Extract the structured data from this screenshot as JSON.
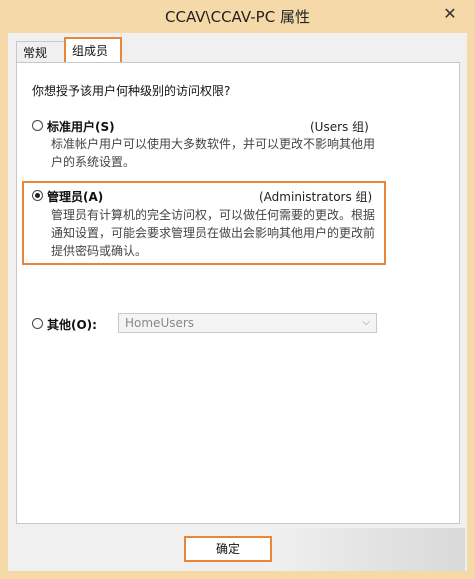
{
  "window": {
    "title": "CCAV\\CCAV-PC 属性",
    "close_glyph": "✕"
  },
  "tabs": [
    {
      "label": "常规",
      "selected": false
    },
    {
      "label": "组成员",
      "selected": true
    }
  ],
  "question": "你想授予该用户何种级别的访问权限?",
  "options": [
    {
      "label": "标准用户(S)",
      "group": "(Users 组)",
      "description": [
        "标准帐户用户可以使用大多数软件，并可以更改不影响其他用",
        "户的系统设置。"
      ],
      "selected": false
    },
    {
      "label": "管理员(A)",
      "group": "(Administrators 组)",
      "description": [
        "管理员有计算机的完全访问权，可以做任何需要的更改。根据",
        "通知设置，可能会要求管理员在做出会影响其他用户的更改前",
        "提供密码或确认。"
      ],
      "selected": true
    },
    {
      "label": "其他(O):",
      "selected": false,
      "dropdown_value": "HomeUsers"
    }
  ],
  "buttons": {
    "ok": "确定"
  },
  "colors": {
    "highlight": "#e8873a",
    "titlebar": "#f6d9a9"
  }
}
